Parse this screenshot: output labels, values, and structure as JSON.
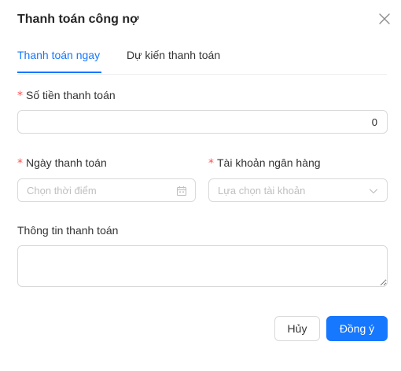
{
  "dialog": {
    "title": "Thanh toán công nợ",
    "close_icon": "close-icon"
  },
  "tabs": [
    {
      "label": "Thanh toán ngay",
      "active": true
    },
    {
      "label": "Dự kiến thanh toán",
      "active": false
    }
  ],
  "form": {
    "amount": {
      "label": "Số tiền thanh toán",
      "required": true,
      "value": "0"
    },
    "date": {
      "label": "Ngày thanh toán",
      "required": true,
      "placeholder": "Chọn thời điểm",
      "icon": "calendar-icon"
    },
    "bank_account": {
      "label": "Tài khoản ngân hàng",
      "required": true,
      "placeholder": "Lựa chọn tài khoản",
      "icon": "chevron-down-icon"
    },
    "payment_info": {
      "label": "Thông tin thanh toán",
      "value": ""
    },
    "required_mark": "*"
  },
  "footer": {
    "cancel_label": "Hủy",
    "confirm_label": "Đồng ý"
  },
  "colors": {
    "primary": "#1677ff",
    "required": "#ff4d4f",
    "border": "#d9d9d9",
    "placeholder": "#bfbfbf"
  }
}
